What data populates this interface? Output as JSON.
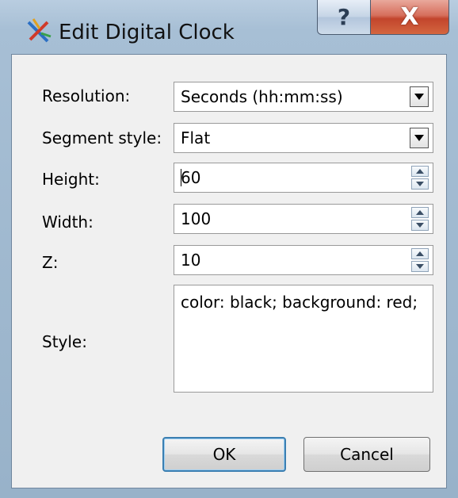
{
  "window": {
    "title": "Edit Digital Clock",
    "help_glyph": "?",
    "close_glyph": "X",
    "icon": "digital-clock-app-icon"
  },
  "form": {
    "resolution": {
      "label": "Resolution:",
      "value": "Seconds (hh:mm:ss)"
    },
    "segment_style": {
      "label": "Segment style:",
      "value": "Flat"
    },
    "height": {
      "label": "Height:",
      "value": "60"
    },
    "width": {
      "label": "Width:",
      "value": "100"
    },
    "z": {
      "label": "Z:",
      "value": "10"
    },
    "style": {
      "label": "Style:",
      "value": "color: black; background: red;"
    }
  },
  "buttons": {
    "ok": "OK",
    "cancel": "Cancel"
  },
  "colors": {
    "ok_focus": "#3c7fb1",
    "close_button": "#c2452c"
  }
}
